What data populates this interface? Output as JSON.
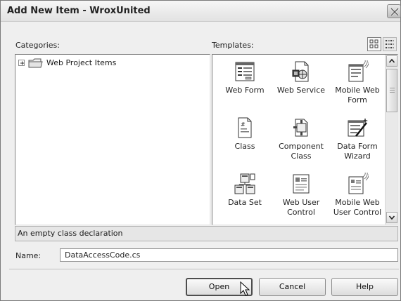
{
  "window": {
    "title": "Add New Item - WroxUnited"
  },
  "categories": {
    "label": "Categories:",
    "items": [
      {
        "label": "Web Project Items",
        "icon": "folder-icon",
        "expander": "plus"
      }
    ]
  },
  "templates": {
    "label": "Templates:",
    "view_buttons": [
      "large-icons-view-icon",
      "list-view-icon"
    ],
    "items": [
      {
        "label": "Web Form",
        "icon": "web-form-icon"
      },
      {
        "label": "Web Service",
        "icon": "web-service-icon"
      },
      {
        "label": "Mobile Web Form",
        "icon": "mobile-web-form-icon"
      },
      {
        "label": "Class",
        "icon": "class-icon",
        "selected": true
      },
      {
        "label": "Component Class",
        "icon": "component-class-icon"
      },
      {
        "label": "Data Form Wizard",
        "icon": "data-form-wizard-icon"
      },
      {
        "label": "Data Set",
        "icon": "data-set-icon"
      },
      {
        "label": "Web User Control",
        "icon": "web-user-control-icon"
      },
      {
        "label": "Mobile Web User Control",
        "icon": "mobile-web-user-control-icon"
      }
    ]
  },
  "description": "An empty class declaration",
  "name_field": {
    "label": "Name:",
    "value": "DataAccessCode.cs"
  },
  "buttons": {
    "open": "Open",
    "cancel": "Cancel",
    "help": "Help"
  },
  "colors": {
    "dialog_bg": "#efefef",
    "panel_bg": "#ffffff",
    "title_bar": "#e6e6e6"
  }
}
